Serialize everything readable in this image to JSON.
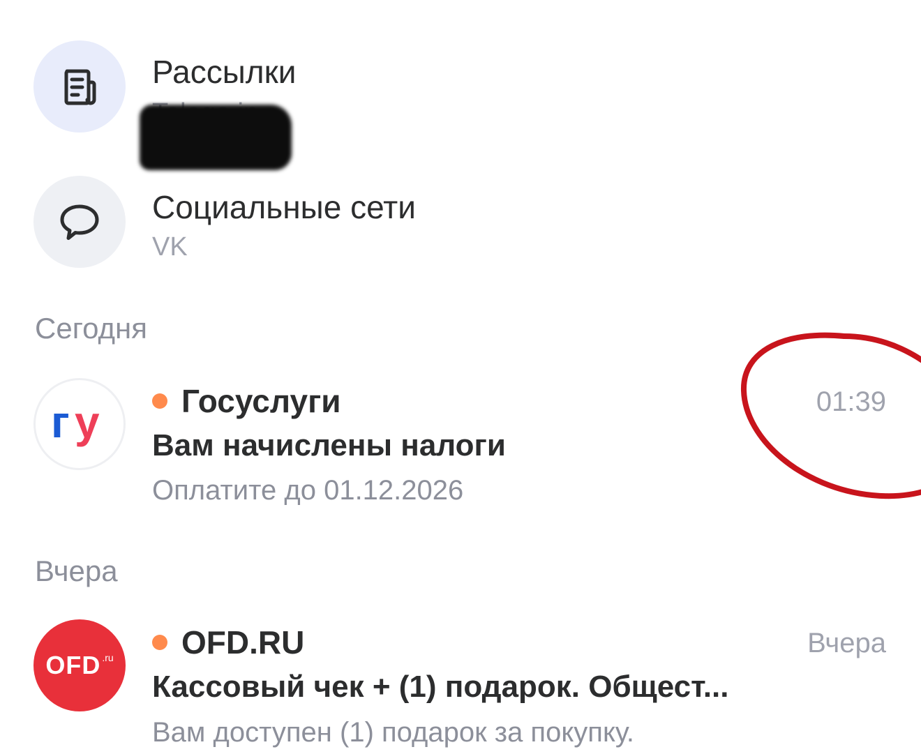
{
  "folders": [
    {
      "title": "Рассылки",
      "subtitle": "Telega.in",
      "icon": "newsletter-icon",
      "icon_bg": "#e8ecfb"
    },
    {
      "title": "Социальные сети",
      "subtitle": "VK",
      "icon": "chat-bubble-icon",
      "icon_bg": "#eef0f4"
    }
  ],
  "sections": [
    {
      "header": "Сегодня",
      "emails": [
        {
          "avatar_text": "гу",
          "sender": "Госуслуги",
          "subject": "Вам начислены налоги",
          "snippet": "Оплатите до 01.12.2026",
          "time": "01:39",
          "unread": true
        }
      ]
    },
    {
      "header": "Вчера",
      "emails": [
        {
          "avatar_text": "OFD",
          "avatar_suffix": ".ru",
          "sender": "OFD.RU",
          "subject": "Кассовый чек + (1) подарок. Общест...",
          "snippet": "Вам доступен (1) подарок за покупку.",
          "time": "Вчера",
          "unread": true
        }
      ]
    }
  ],
  "colors": {
    "unread_dot": "#ff8a4c",
    "annotation_circle": "#c8141c",
    "gu_blue": "#1b5bd4",
    "gu_red": "#ee3f58",
    "ofd_red": "#e8303a"
  }
}
